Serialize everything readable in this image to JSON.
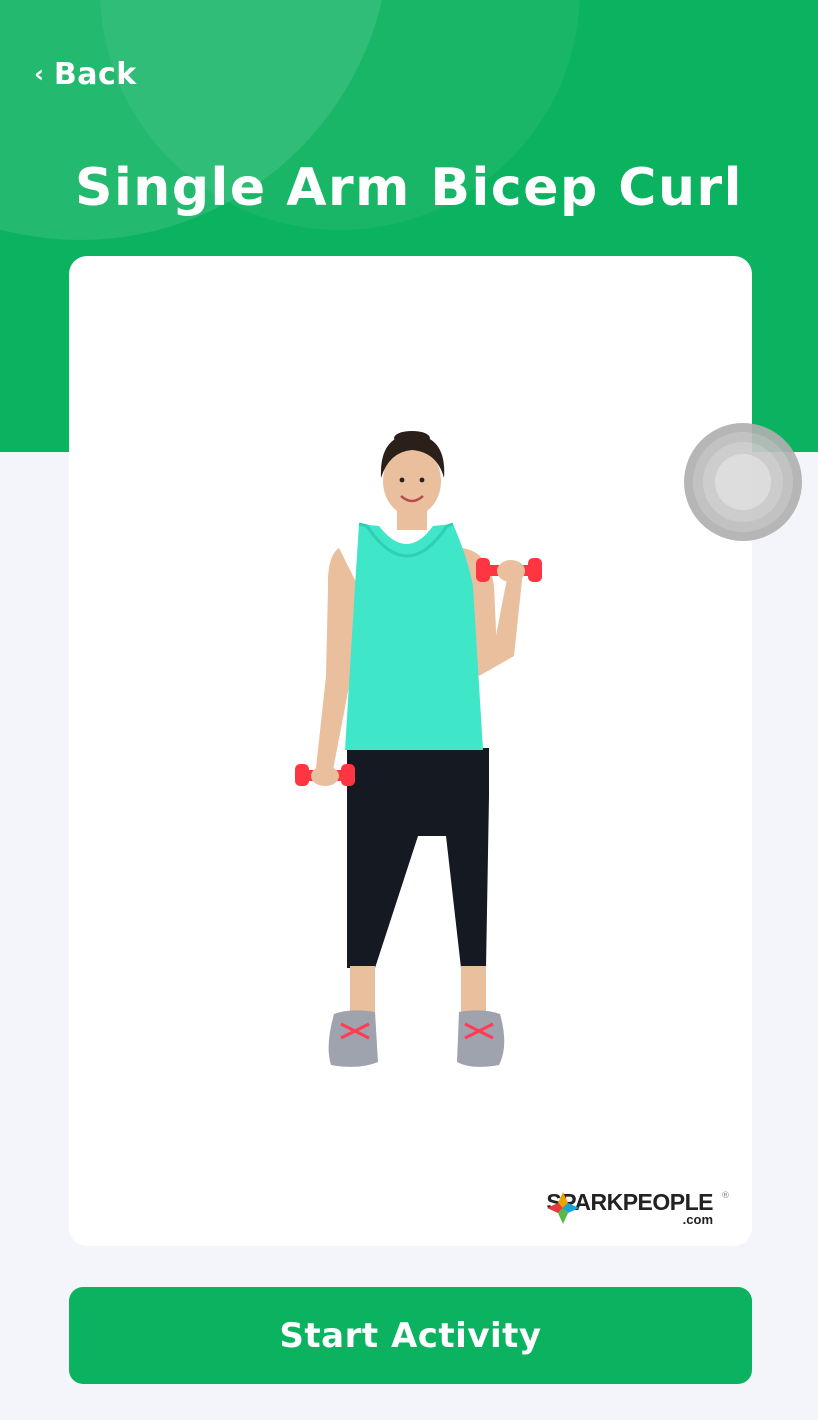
{
  "header": {
    "back_label": "Back",
    "title": "Single Arm Bicep Curl"
  },
  "exercise_image": {
    "alt": "Woman performing single arm bicep curl with red dumbbells",
    "logo": {
      "brand": "SPARKPEOPLE",
      "suffix": ".com",
      "registered": "®"
    }
  },
  "actions": {
    "start_label": "Start Activity"
  },
  "colors": {
    "accent": "#0bb25f",
    "background": "#f4f5fb",
    "card": "#ffffff"
  },
  "icons": {
    "back": "chevron-left-icon",
    "touch_indicator": "touch-indicator"
  }
}
